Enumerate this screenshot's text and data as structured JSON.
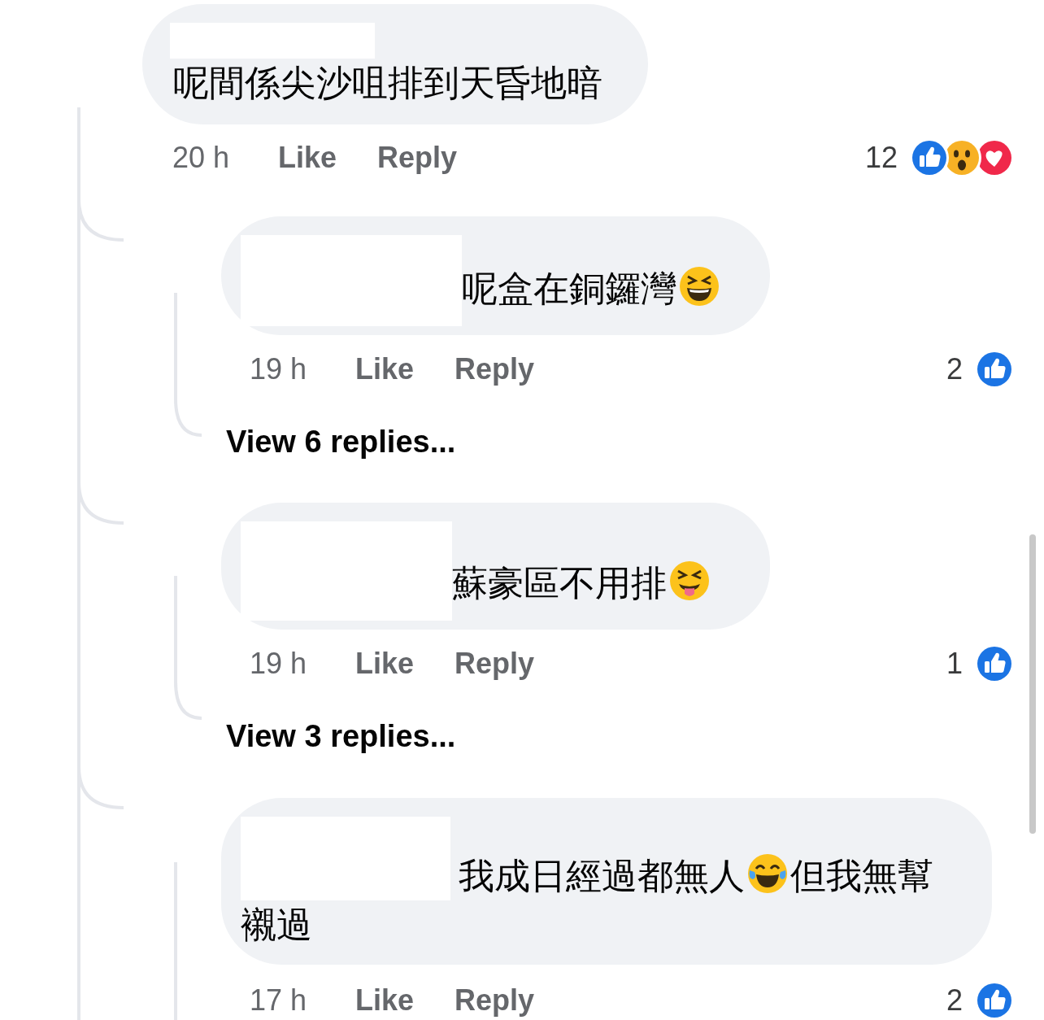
{
  "comments": [
    {
      "name_hidden": true,
      "text": [
        {
          "kind": "text",
          "text": "呢間係尖沙咀排到天昏地暗"
        }
      ],
      "time": "20 h",
      "like": "Like",
      "reply": "Reply",
      "reaction_count": "12",
      "reactions": [
        {
          "kind": "like"
        },
        {
          "kind": "wow"
        },
        {
          "kind": "love"
        }
      ],
      "children": [
        {
          "name_hidden": true,
          "text": [
            {
              "kind": "text",
              "text": "呢盒在銅鑼灣"
            },
            {
              "kind": "squint"
            }
          ],
          "time": "19 h",
          "like": "Like",
          "reply": "Reply",
          "reaction_count": "2",
          "reactions": [
            {
              "kind": "like"
            }
          ],
          "more_replies": "View 6 replies..."
        },
        {
          "name_hidden": true,
          "text": [
            {
              "kind": "text",
              "text": "蘇豪區不用排"
            },
            {
              "kind": "tongue"
            }
          ],
          "time": "19 h",
          "like": "Like",
          "reply": "Reply",
          "reaction_count": "1",
          "reactions": [
            {
              "kind": "like"
            }
          ],
          "more_replies": "View 3 replies..."
        },
        {
          "name_hidden": true,
          "text": [
            {
              "kind": "text",
              "text": "我成日經過都無人"
            },
            {
              "kind": "tears"
            },
            {
              "kind": "text",
              "text": "但我無幫"
            },
            {
              "kind": "text",
              "text": "襯過"
            }
          ],
          "time": "17 h",
          "like": "Like",
          "reply": "Reply",
          "reaction_count": "2",
          "reactions": [
            {
              "kind": "like"
            }
          ]
        }
      ]
    }
  ]
}
